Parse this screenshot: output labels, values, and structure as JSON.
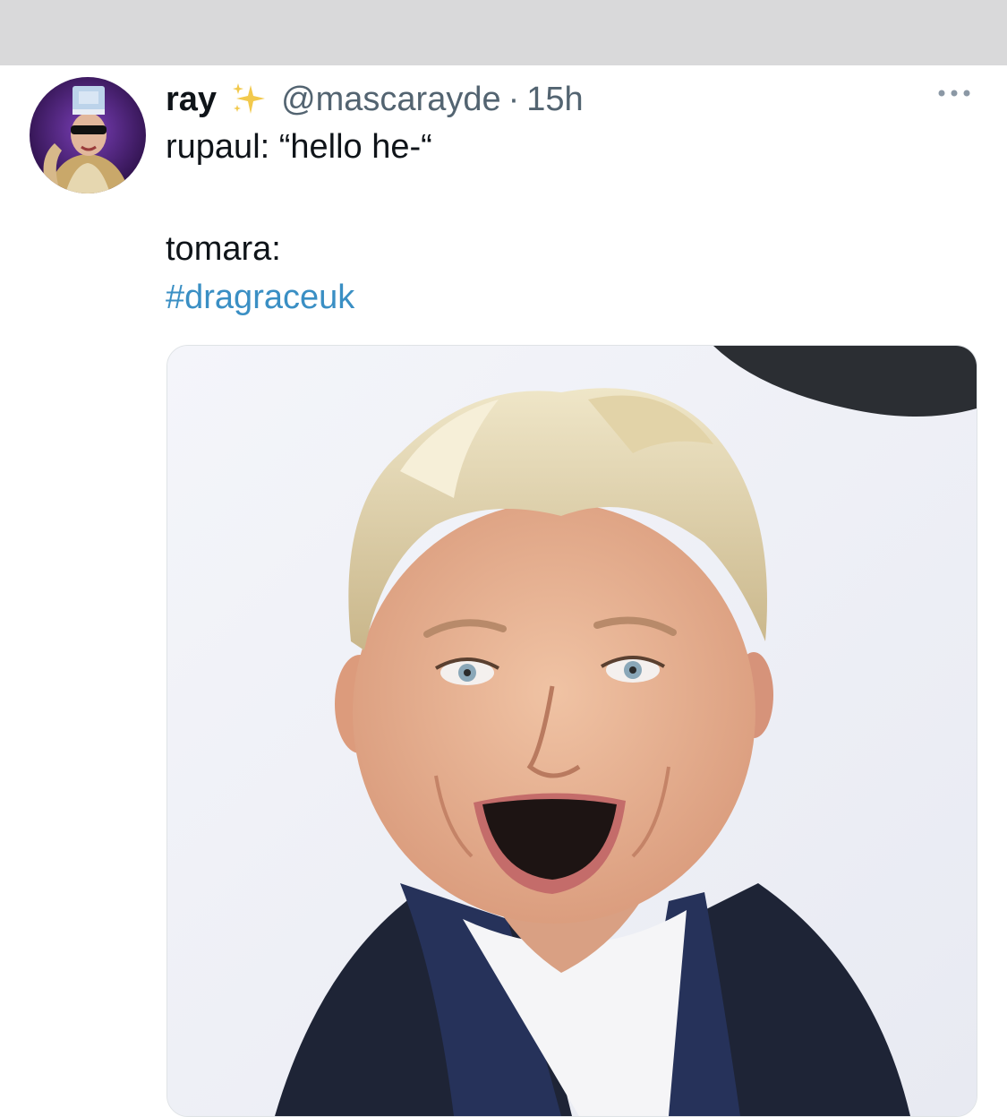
{
  "tweet": {
    "display_name": "ray",
    "handle": "@mascarayde",
    "separator": "·",
    "time": "15h",
    "text_line_1": "rupaul: “hello he-“",
    "text_line_2": "tomara:",
    "hashtag": "#dragraceuk",
    "icons": {
      "verified_emoji": "sparkles-icon",
      "more": "more-horizontal-icon"
    }
  },
  "colors": {
    "top_bar": "#d9d9da",
    "secondary_text": "#536471",
    "hashtag": "#3a8fc4",
    "sparkle": "#f2c94c"
  }
}
